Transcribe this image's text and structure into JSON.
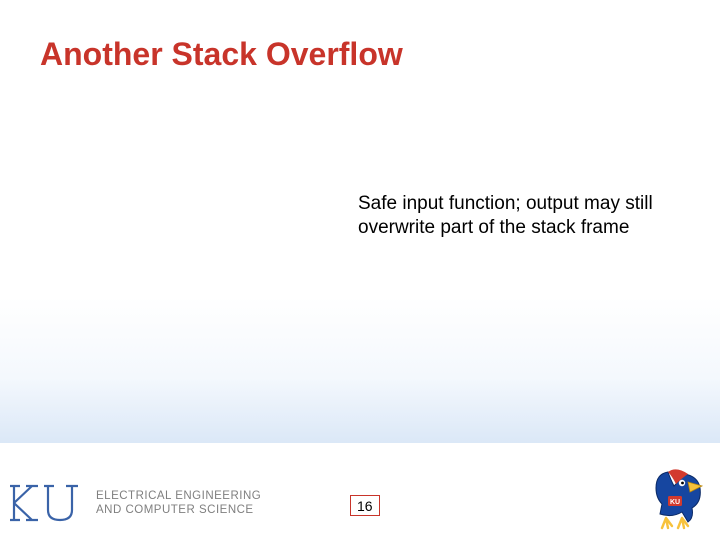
{
  "slide": {
    "title": "Another Stack Overflow",
    "body": "Safe input function; output may still overwrite part of the stack frame",
    "page_number": "16"
  },
  "footer": {
    "dept_line1": "ELECTRICAL ENGINEERING",
    "dept_line2": "AND COMPUTER SCIENCE",
    "ku_badge": "KU"
  }
}
